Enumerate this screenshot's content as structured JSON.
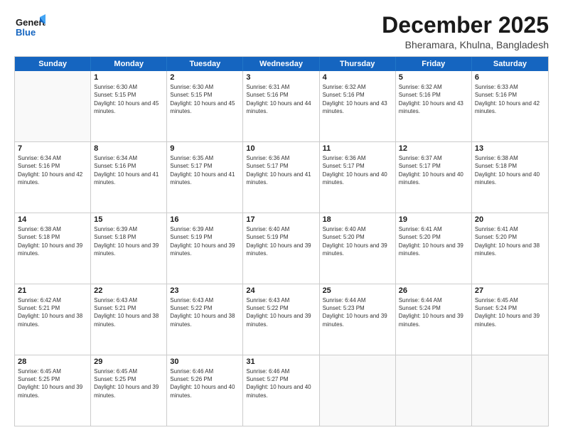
{
  "logo": {
    "line1": "General",
    "line2": "Blue"
  },
  "title": "December 2025",
  "subtitle": "Bheramara, Khulna, Bangladesh",
  "days": [
    "Sunday",
    "Monday",
    "Tuesday",
    "Wednesday",
    "Thursday",
    "Friday",
    "Saturday"
  ],
  "weeks": [
    [
      {
        "day": "",
        "empty": true
      },
      {
        "day": "1",
        "sunrise": "6:30 AM",
        "sunset": "5:15 PM",
        "daylight": "10 hours and 45 minutes."
      },
      {
        "day": "2",
        "sunrise": "6:30 AM",
        "sunset": "5:15 PM",
        "daylight": "10 hours and 45 minutes."
      },
      {
        "day": "3",
        "sunrise": "6:31 AM",
        "sunset": "5:16 PM",
        "daylight": "10 hours and 44 minutes."
      },
      {
        "day": "4",
        "sunrise": "6:32 AM",
        "sunset": "5:16 PM",
        "daylight": "10 hours and 43 minutes."
      },
      {
        "day": "5",
        "sunrise": "6:32 AM",
        "sunset": "5:16 PM",
        "daylight": "10 hours and 43 minutes."
      },
      {
        "day": "6",
        "sunrise": "6:33 AM",
        "sunset": "5:16 PM",
        "daylight": "10 hours and 42 minutes."
      }
    ],
    [
      {
        "day": "7",
        "sunrise": "6:34 AM",
        "sunset": "5:16 PM",
        "daylight": "10 hours and 42 minutes."
      },
      {
        "day": "8",
        "sunrise": "6:34 AM",
        "sunset": "5:16 PM",
        "daylight": "10 hours and 41 minutes."
      },
      {
        "day": "9",
        "sunrise": "6:35 AM",
        "sunset": "5:17 PM",
        "daylight": "10 hours and 41 minutes."
      },
      {
        "day": "10",
        "sunrise": "6:36 AM",
        "sunset": "5:17 PM",
        "daylight": "10 hours and 41 minutes."
      },
      {
        "day": "11",
        "sunrise": "6:36 AM",
        "sunset": "5:17 PM",
        "daylight": "10 hours and 40 minutes."
      },
      {
        "day": "12",
        "sunrise": "6:37 AM",
        "sunset": "5:17 PM",
        "daylight": "10 hours and 40 minutes."
      },
      {
        "day": "13",
        "sunrise": "6:38 AM",
        "sunset": "5:18 PM",
        "daylight": "10 hours and 40 minutes."
      }
    ],
    [
      {
        "day": "14",
        "sunrise": "6:38 AM",
        "sunset": "5:18 PM",
        "daylight": "10 hours and 39 minutes."
      },
      {
        "day": "15",
        "sunrise": "6:39 AM",
        "sunset": "5:18 PM",
        "daylight": "10 hours and 39 minutes."
      },
      {
        "day": "16",
        "sunrise": "6:39 AM",
        "sunset": "5:19 PM",
        "daylight": "10 hours and 39 minutes."
      },
      {
        "day": "17",
        "sunrise": "6:40 AM",
        "sunset": "5:19 PM",
        "daylight": "10 hours and 39 minutes."
      },
      {
        "day": "18",
        "sunrise": "6:40 AM",
        "sunset": "5:20 PM",
        "daylight": "10 hours and 39 minutes."
      },
      {
        "day": "19",
        "sunrise": "6:41 AM",
        "sunset": "5:20 PM",
        "daylight": "10 hours and 39 minutes."
      },
      {
        "day": "20",
        "sunrise": "6:41 AM",
        "sunset": "5:20 PM",
        "daylight": "10 hours and 38 minutes."
      }
    ],
    [
      {
        "day": "21",
        "sunrise": "6:42 AM",
        "sunset": "5:21 PM",
        "daylight": "10 hours and 38 minutes."
      },
      {
        "day": "22",
        "sunrise": "6:43 AM",
        "sunset": "5:21 PM",
        "daylight": "10 hours and 38 minutes."
      },
      {
        "day": "23",
        "sunrise": "6:43 AM",
        "sunset": "5:22 PM",
        "daylight": "10 hours and 38 minutes."
      },
      {
        "day": "24",
        "sunrise": "6:43 AM",
        "sunset": "5:22 PM",
        "daylight": "10 hours and 39 minutes."
      },
      {
        "day": "25",
        "sunrise": "6:44 AM",
        "sunset": "5:23 PM",
        "daylight": "10 hours and 39 minutes."
      },
      {
        "day": "26",
        "sunrise": "6:44 AM",
        "sunset": "5:24 PM",
        "daylight": "10 hours and 39 minutes."
      },
      {
        "day": "27",
        "sunrise": "6:45 AM",
        "sunset": "5:24 PM",
        "daylight": "10 hours and 39 minutes."
      }
    ],
    [
      {
        "day": "28",
        "sunrise": "6:45 AM",
        "sunset": "5:25 PM",
        "daylight": "10 hours and 39 minutes."
      },
      {
        "day": "29",
        "sunrise": "6:45 AM",
        "sunset": "5:25 PM",
        "daylight": "10 hours and 39 minutes."
      },
      {
        "day": "30",
        "sunrise": "6:46 AM",
        "sunset": "5:26 PM",
        "daylight": "10 hours and 40 minutes."
      },
      {
        "day": "31",
        "sunrise": "6:46 AM",
        "sunset": "5:27 PM",
        "daylight": "10 hours and 40 minutes."
      },
      {
        "day": "",
        "empty": true
      },
      {
        "day": "",
        "empty": true
      },
      {
        "day": "",
        "empty": true
      }
    ]
  ]
}
